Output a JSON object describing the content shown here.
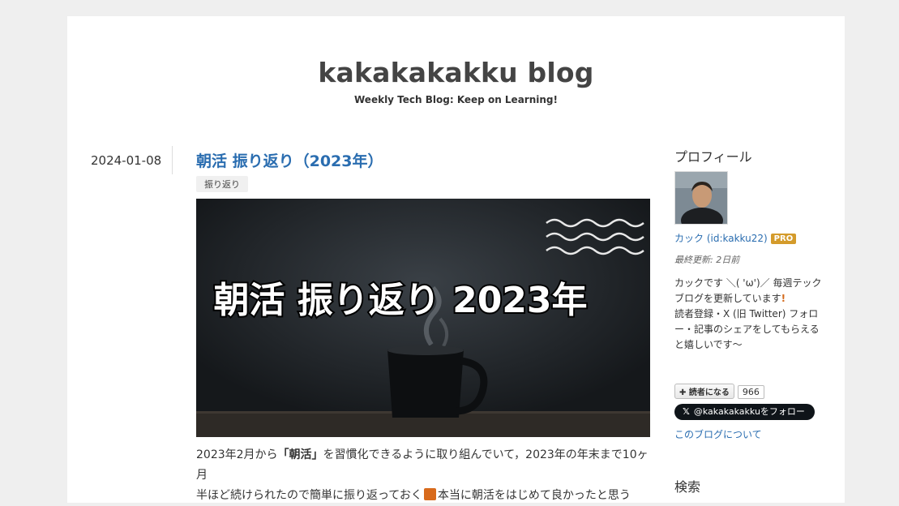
{
  "blog": {
    "title": "kakakakakku blog",
    "description": "Weekly Tech Blog: Keep on Learning!"
  },
  "entry": {
    "date": "2024-01-08",
    "title": "朝活 振り返り（2023年）",
    "category": "振り返り",
    "eyecatch_text": "朝活 振り返り 2023年",
    "body": {
      "line1_pre": "2023年2月から",
      "line1_bold": "「朝活」",
      "line1_post": "を習慣化できるように取り組んでいて，2023年の年末まで10ヶ月",
      "line2_pre": "半ほど続けられたので簡単に振り返っておく",
      "line2_post": "本当に朝活をはじめて良かったと思う"
    }
  },
  "sidebar": {
    "profile_heading": "プロフィール",
    "profile_name": "カック (id:kakku22)",
    "pro_badge": "PRO",
    "updated": "最終更新: 2日前",
    "profile_text_1": "カックです ＼( 'ω')／ 毎週テックブログを更新しています",
    "profile_text_2": "読者登録・X (旧 Twitter) フォロー・記事のシェアをしてもらえると嬉しいです〜",
    "subscribe_label": "読者になる",
    "subscribe_count": "966",
    "x_follow_label": "@kakakakakkuをフォロー",
    "about_link": "このブログについて",
    "search_heading": "検索"
  },
  "colors": {
    "link": "#2a6db0",
    "pro_badge": "#d49b2b"
  }
}
